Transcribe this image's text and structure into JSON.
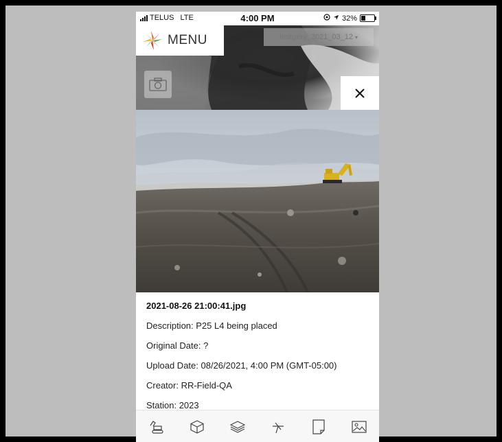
{
  "status_bar": {
    "carrier": "TELUS",
    "network": "LTE",
    "time": "4:00 PM",
    "battery_percent": "32%",
    "battery_level": 0.32
  },
  "header": {
    "menu_label": "MENU",
    "imagery_selected": "Imagery_2021_03_12"
  },
  "photo": {
    "filename": "2021-08-26 21:00:41.jpg",
    "description": "Description: P25 L4 being placed",
    "original_date": "Original Date: ?",
    "upload_date": "Upload Date: 08/26/2021, 4:00 PM (GMT-05:00)",
    "creator": "Creator: RR-Field-QA",
    "station": "Station: 2023"
  },
  "toolbar": {
    "items": [
      {
        "icon": "excavator-icon"
      },
      {
        "icon": "cube-icon"
      },
      {
        "icon": "layers-icon"
      },
      {
        "icon": "measure-icon"
      },
      {
        "icon": "document-icon"
      },
      {
        "icon": "image-icon"
      }
    ]
  },
  "colors": {
    "logo_orange": "#e8742a",
    "logo_green": "#5aa83c",
    "logo_red": "#c8322c",
    "logo_yellow": "#f2b31c"
  }
}
